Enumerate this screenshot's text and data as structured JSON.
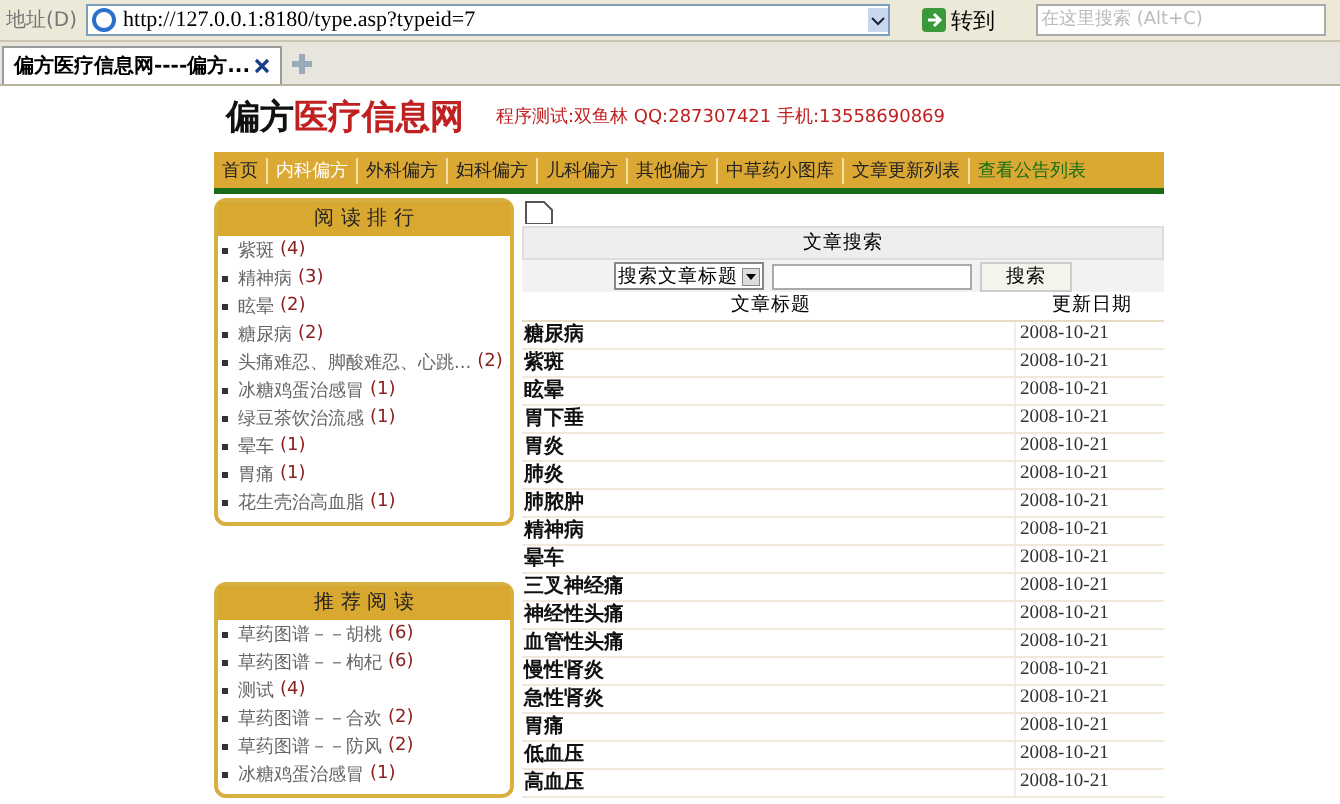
{
  "browser": {
    "address_label": "地址(D)",
    "url": "http://127.0.0.1:8180/type.asp?typeid=7",
    "go_button": "转到",
    "search_placeholder": "在这里搜索 (Alt+C)",
    "tabs": [
      {
        "title": "偏方医疗信息网----偏方...",
        "selected": true
      }
    ]
  },
  "header": {
    "logo_dark": "偏方",
    "logo_red": "医疗信息网",
    "contact": "程序测试:双鱼林 QQ:287307421 手机:13558690869"
  },
  "nav": [
    {
      "label": "首页",
      "selected": false,
      "kind": "link"
    },
    {
      "label": "内科偏方",
      "selected": true,
      "kind": "link"
    },
    {
      "label": "外科偏方",
      "selected": false,
      "kind": "link"
    },
    {
      "label": "妇科偏方",
      "selected": false,
      "kind": "link"
    },
    {
      "label": "儿科偏方",
      "selected": false,
      "kind": "link"
    },
    {
      "label": "其他偏方",
      "selected": false,
      "kind": "link"
    },
    {
      "label": "中草药小图库",
      "selected": false,
      "kind": "link"
    },
    {
      "label": "文章更新列表",
      "selected": false,
      "kind": "link"
    },
    {
      "label": "查看公告列表",
      "selected": false,
      "kind": "notice"
    }
  ],
  "ranking": {
    "title": "阅 读 排 行",
    "items": [
      {
        "title": "紫斑",
        "count": "(4)"
      },
      {
        "title": "精神病",
        "count": "(3)"
      },
      {
        "title": "眩晕",
        "count": "(2)"
      },
      {
        "title": "糖尿病",
        "count": "(2)"
      },
      {
        "title": "头痛难忍、脚酸难忍、心跳...",
        "count": "(2)"
      },
      {
        "title": "冰糖鸡蛋治感冒",
        "count": "(1)"
      },
      {
        "title": "绿豆茶饮治流感",
        "count": "(1)"
      },
      {
        "title": "晕车",
        "count": "(1)"
      },
      {
        "title": "胃痛",
        "count": "(1)"
      },
      {
        "title": "花生壳治高血脂",
        "count": "(1)"
      }
    ]
  },
  "recommended": {
    "title": "推 荐 阅 读",
    "items": [
      {
        "title": "草药图谱－－胡桃",
        "count": "(6)"
      },
      {
        "title": "草药图谱－－枸杞",
        "count": "(6)"
      },
      {
        "title": "测试",
        "count": "(4)"
      },
      {
        "title": "草药图谱－－合欢",
        "count": "(2)"
      },
      {
        "title": "草药图谱－－防风",
        "count": "(2)"
      },
      {
        "title": "冰糖鸡蛋治感冒",
        "count": "(1)"
      }
    ]
  },
  "search": {
    "title": "文章搜索",
    "select": "搜索文章标题",
    "button": "搜索"
  },
  "table": {
    "columns": [
      "文章标题",
      "更新日期"
    ],
    "rows": [
      {
        "title": "糖尿病",
        "date": "2008-10-21"
      },
      {
        "title": "紫斑",
        "date": "2008-10-21"
      },
      {
        "title": "眩晕",
        "date": "2008-10-21"
      },
      {
        "title": "胃下垂",
        "date": "2008-10-21"
      },
      {
        "title": "胃炎",
        "date": "2008-10-21"
      },
      {
        "title": "肺炎",
        "date": "2008-10-21"
      },
      {
        "title": "肺脓肿",
        "date": "2008-10-21"
      },
      {
        "title": "精神病",
        "date": "2008-10-21"
      },
      {
        "title": "晕车",
        "date": "2008-10-21"
      },
      {
        "title": "三叉神经痛",
        "date": "2008-10-21"
      },
      {
        "title": "神经性头痛",
        "date": "2008-10-21"
      },
      {
        "title": "血管性头痛",
        "date": "2008-10-21"
      },
      {
        "title": "慢性肾炎",
        "date": "2008-10-21"
      },
      {
        "title": "急性肾炎",
        "date": "2008-10-21"
      },
      {
        "title": "胃痛",
        "date": "2008-10-21"
      },
      {
        "title": "低血压",
        "date": "2008-10-21"
      },
      {
        "title": "高血压",
        "date": "2008-10-21"
      }
    ]
  }
}
